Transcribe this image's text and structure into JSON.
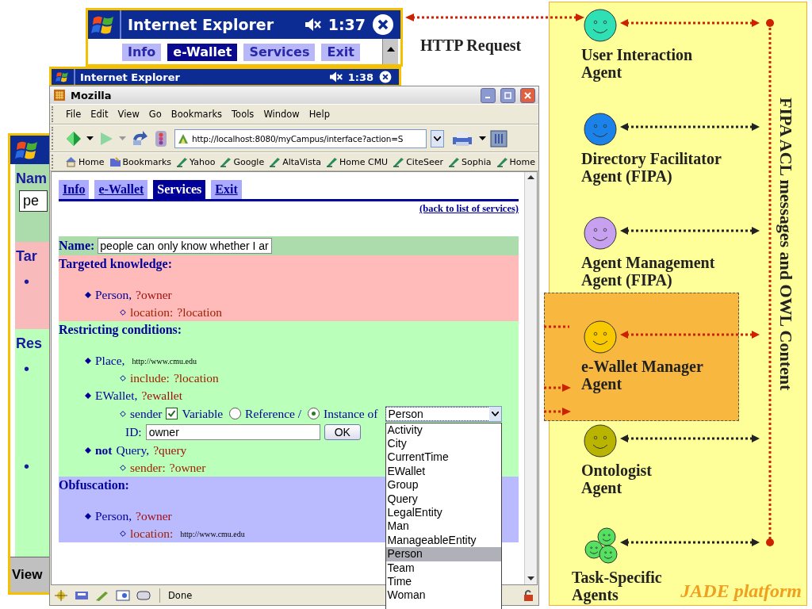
{
  "pda_windows": [
    {
      "title": "Internet Explorer",
      "time": "1:37",
      "tabs": [
        {
          "label": "Info",
          "selected": false
        },
        {
          "label": "e-Wallet",
          "selected": true
        },
        {
          "label": "Services",
          "selected": false
        },
        {
          "label": "Exit",
          "selected": false
        }
      ]
    },
    {
      "title": "Internet Explorer",
      "time": "1:38"
    }
  ],
  "pda_side": {
    "rows": [
      {
        "kind": "name",
        "label": "Nam",
        "value": "pe",
        "color": "#acdcac"
      },
      {
        "kind": "section",
        "label": "Tar",
        "bullets": [
          "•"
        ],
        "color": "#f8baba"
      },
      {
        "kind": "section",
        "label": "Res",
        "bullets": [
          "•",
          "•"
        ],
        "color": "#baffba"
      }
    ],
    "menu_label": "View"
  },
  "http_label": "HTTP Request",
  "mozilla": {
    "title": "Mozilla",
    "menu": [
      "File",
      "Edit",
      "View",
      "Go",
      "Bookmarks",
      "Tools",
      "Window",
      "Help"
    ],
    "url": "http://localhost:8080/myCampus/interface?action=S",
    "bookmarks": [
      {
        "label": "Home",
        "kind": "home"
      },
      {
        "label": "Bookmarks",
        "kind": "folder"
      },
      {
        "label": "Yahoo",
        "kind": "link"
      },
      {
        "label": "Google",
        "kind": "link"
      },
      {
        "label": "AltaVista",
        "kind": "link"
      },
      {
        "label": "Home CMU",
        "kind": "link"
      },
      {
        "label": "CiteSeer",
        "kind": "link"
      },
      {
        "label": "Sophia",
        "kind": "link"
      },
      {
        "label": "Home",
        "kind": "link"
      }
    ],
    "page": {
      "tabs": [
        {
          "label": "Info",
          "selected": false
        },
        {
          "label": "e-Wallet",
          "selected": false
        },
        {
          "label": "Services",
          "selected": true
        },
        {
          "label": "Exit",
          "selected": false
        }
      ],
      "back_link": "(back to list of services)",
      "name_row": {
        "label": "Name:",
        "value": "people can only know whether I ar",
        "color": "#acdcac"
      },
      "sections": [
        {
          "heading": "Targeted knowledge:",
          "color": "#ffbaba",
          "items": [
            {
              "class": "Person,",
              "variable": "?owner",
              "children": [
                {
                  "kind": "text",
                  "property": "location:",
                  "variable": "?location"
                }
              ]
            }
          ]
        },
        {
          "heading": "Restricting conditions:",
          "color": "#baffba",
          "items": [
            {
              "class": "Place,",
              "url": "http://www.cmu.edu",
              "children": [
                {
                  "kind": "text",
                  "property": "include:",
                  "variable": "?location"
                }
              ]
            },
            {
              "class": "EWallet,",
              "variable": "?ewallet",
              "children": [
                {
                  "kind": "form",
                  "property": "sender",
                  "checkbox": {
                    "label": "Variable",
                    "checked": true
                  },
                  "radios": [
                    {
                      "label": "Reference /",
                      "selected": false
                    },
                    {
                      "label": "Instance of",
                      "selected": true
                    }
                  ],
                  "select": {
                    "value": "Person",
                    "options": [
                      {
                        "label": "Activity",
                        "selected": false
                      },
                      {
                        "label": "City",
                        "selected": false
                      },
                      {
                        "label": "CurrentTime",
                        "selected": false
                      },
                      {
                        "label": "EWallet",
                        "selected": false
                      },
                      {
                        "label": "Group",
                        "selected": false
                      },
                      {
                        "label": "Query",
                        "selected": false
                      },
                      {
                        "label": "LegalEntity",
                        "selected": false
                      },
                      {
                        "label": "Man",
                        "selected": false
                      },
                      {
                        "label": "ManageableEntity",
                        "selected": false
                      },
                      {
                        "label": "Person",
                        "selected": true
                      },
                      {
                        "label": "Team",
                        "selected": false
                      },
                      {
                        "label": "Time",
                        "selected": false
                      },
                      {
                        "label": "Woman",
                        "selected": false
                      }
                    ]
                  },
                  "id_label": "ID:",
                  "id_value": "owner",
                  "button": "OK"
                }
              ]
            },
            {
              "keyword": "not",
              "class": "Query,",
              "variable": "?query",
              "children": [
                {
                  "kind": "text",
                  "property": "sender:",
                  "variable": "?owner"
                }
              ]
            }
          ]
        },
        {
          "heading": "Obfuscation:",
          "color": "#babaff",
          "items": [
            {
              "class": "Person,",
              "variable": "?owner",
              "children": [
                {
                  "kind": "text",
                  "property": "location:",
                  "url": "http://www.cmu.edu"
                }
              ]
            }
          ]
        }
      ]
    },
    "status": "Done"
  },
  "platform": {
    "bus_label": "FIPA ACL messages and OWL Content",
    "name": "JADE platform",
    "agents": [
      {
        "lines": [
          "User Interaction",
          "Agent"
        ],
        "kind": "single",
        "color": "#2ee0b4",
        "link": {
          "color": "#cc2200"
        },
        "boxed": false
      },
      {
        "lines": [
          "Directory Facilitator",
          "Agent (FIPA)"
        ],
        "kind": "single",
        "color": "#1a82e8",
        "link": {
          "color": "#222222"
        },
        "boxed": false
      },
      {
        "lines": [
          "Agent Management",
          "Agent (FIPA)"
        ],
        "kind": "single",
        "color": "#c8a0f0",
        "link": {
          "color": "#222222"
        },
        "boxed": false
      },
      {
        "lines": [
          "e-Wallet Manager",
          "Agent"
        ],
        "kind": "single",
        "color": "#f8c800",
        "link": {
          "color": "#cc2200"
        },
        "boxed": true
      },
      {
        "lines": [
          "Ontologist",
          "Agent"
        ],
        "kind": "single",
        "color": "#b8b400",
        "link": {
          "color": "#222222"
        },
        "boxed": false
      },
      {
        "lines": [
          "Task-Specific",
          "Agents"
        ],
        "kind": "group",
        "color": "#55e060",
        "link": {
          "color": "#222222"
        },
        "boxed": false
      }
    ]
  }
}
